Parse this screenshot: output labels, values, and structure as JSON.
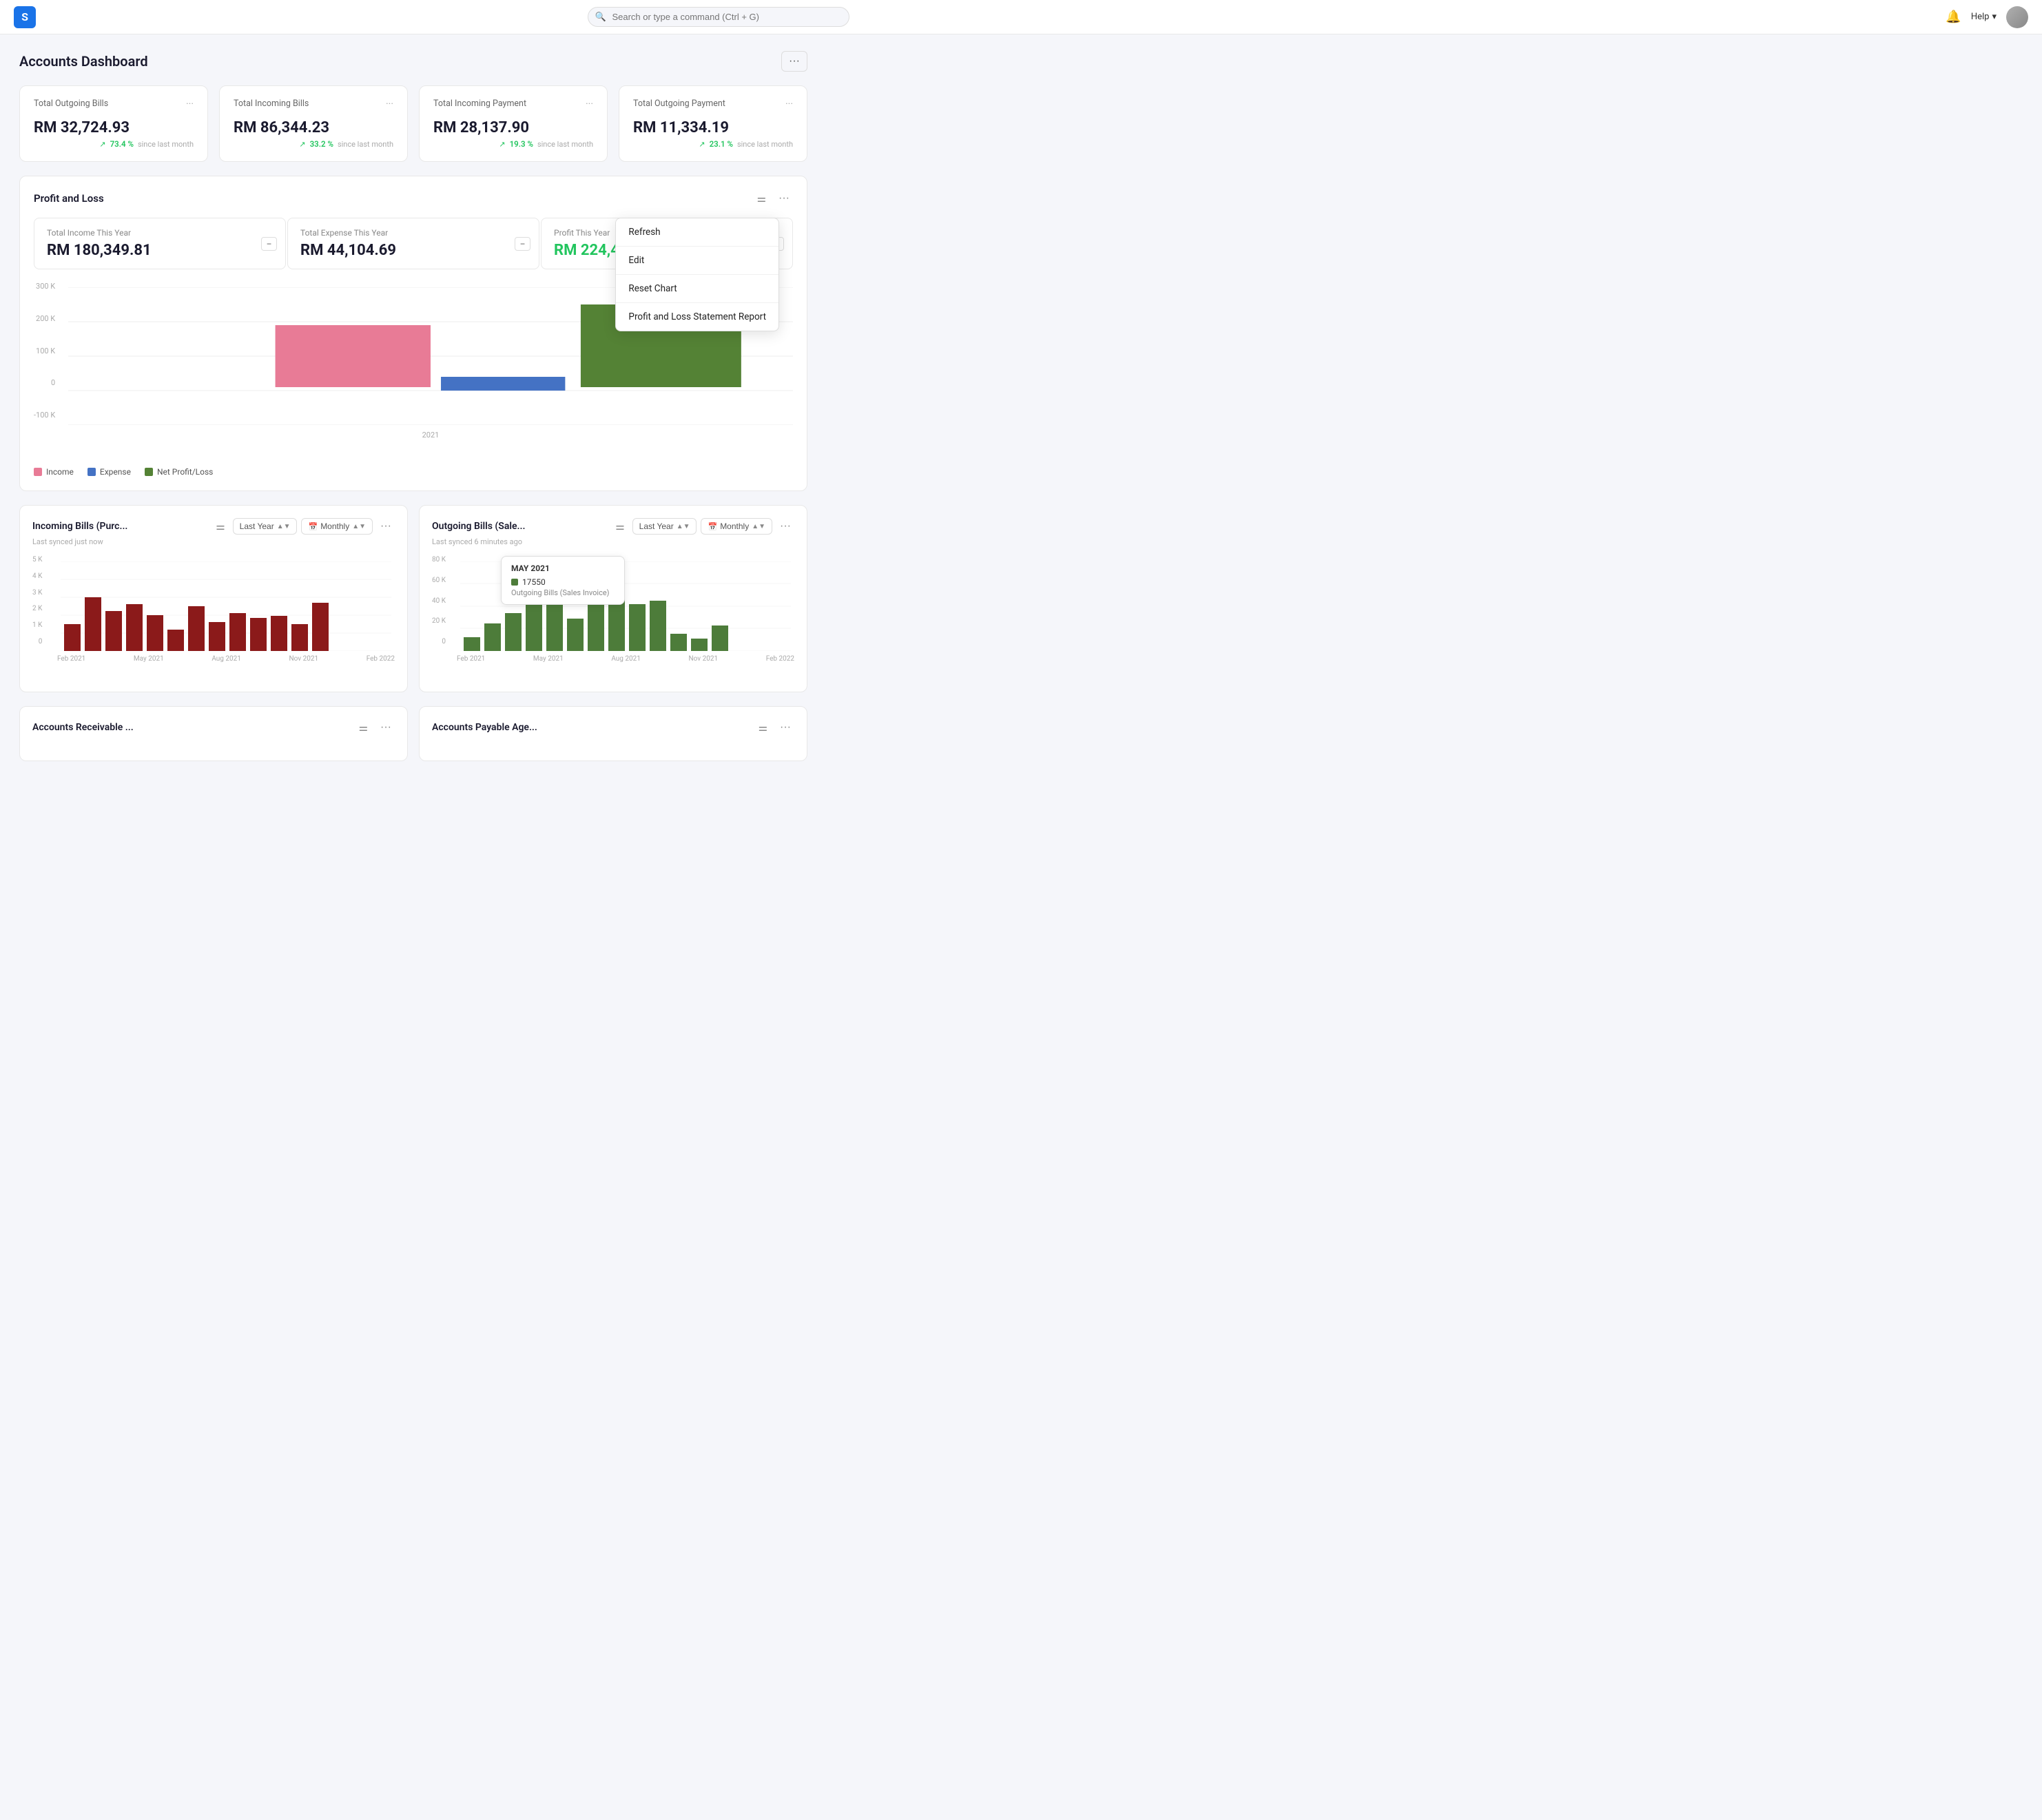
{
  "app": {
    "logo_letter": "S",
    "search_placeholder": "Search or type a command (Ctrl + G)"
  },
  "header": {
    "title": "Accounts Dashboard",
    "more_label": "···"
  },
  "kpis": [
    {
      "id": "total-outgoing-bills",
      "title": "Total Outgoing Bills",
      "value": "RM 32,724.93",
      "pct": "73.4 %",
      "since": "since last month"
    },
    {
      "id": "total-incoming-bills",
      "title": "Total Incoming Bills",
      "value": "RM 86,344.23",
      "pct": "33.2 %",
      "since": "since last month"
    },
    {
      "id": "total-incoming-payment",
      "title": "Total Incoming Payment",
      "value": "RM 28,137.90",
      "pct": "19.3 %",
      "since": "since last month"
    },
    {
      "id": "total-outgoing-payment",
      "title": "Total Outgoing Payment",
      "value": "RM 11,334.19",
      "pct": "23.1 %",
      "since": "since last month"
    }
  ],
  "profit_loss": {
    "title": "Profit and Loss",
    "summary": [
      {
        "label": "Total Income This Year",
        "value": "RM 180,349.81",
        "green": false
      },
      {
        "label": "Total Expense This Year",
        "value": "RM 44,104.69",
        "green": false
      },
      {
        "label": "Profit This Year",
        "value": "RM 224,454.50",
        "green": true
      }
    ],
    "chart_year": "2021",
    "legend": [
      {
        "label": "Income",
        "color": "#e87b96"
      },
      {
        "label": "Expense",
        "color": "#4472c4"
      },
      {
        "label": "Net Profit/Loss",
        "color": "#548235"
      }
    ],
    "dropdown_menu": [
      {
        "label": "Refresh"
      },
      {
        "label": "Edit"
      },
      {
        "label": "Reset Chart"
      },
      {
        "label": "Profit and Loss Statement Report"
      }
    ]
  },
  "incoming_bills": {
    "title": "Incoming Bills (Purc...",
    "subtitle": "Last synced just now",
    "period_label": "Last Year",
    "frequency_label": "Monthly",
    "bars": [
      35,
      75,
      45,
      60,
      50,
      28,
      55,
      35,
      45,
      38,
      42,
      32,
      55
    ],
    "x_labels": [
      "Feb 2021",
      "May 2021",
      "Aug 2021",
      "Nov 2021",
      "Feb 2022"
    ],
    "y_max": "5 K",
    "y_mid": "",
    "color": "#8b1a1a"
  },
  "outgoing_bills": {
    "title": "Outgoing Bills (Sale...",
    "subtitle": "Last synced 6 minutes ago",
    "period_label": "Last Year",
    "frequency_label": "Monthly",
    "tooltip": {
      "date": "MAY 2021",
      "value": "17550",
      "label": "Outgoing Bills (Sales Invoice)"
    },
    "bars": [
      12,
      30,
      45,
      55,
      75,
      38,
      82,
      58,
      45,
      52,
      18,
      12,
      20
    ],
    "x_labels": [
      "Feb 2021",
      "May 2021",
      "Aug 2021",
      "Nov 2021",
      "Feb 2022"
    ],
    "y_max": "80 K",
    "y_mid": "60 K",
    "color": "#4d7c3a"
  },
  "accounts_receivable": {
    "title": "Accounts Receivable ..."
  },
  "accounts_payable": {
    "title": "Accounts Payable Age..."
  }
}
